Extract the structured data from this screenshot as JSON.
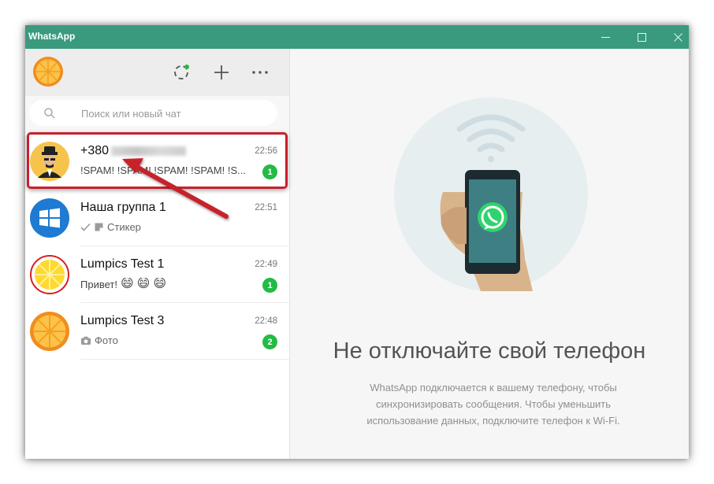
{
  "window": {
    "title": "WhatsApp",
    "minimize": "—",
    "maximize": "☐",
    "close": "✕"
  },
  "sidebar": {
    "search": {
      "placeholder": "Поиск или новый чат"
    },
    "chats": [
      {
        "name": "+380",
        "name_blurred": true,
        "time": "22:56",
        "preview": "!SPAM! !SPAM! !SPAM! !SPAM! !S...",
        "unread": "1",
        "avatar": "spy-avatar",
        "highlighted": true
      },
      {
        "name": "Наша группа 1",
        "time": "22:51",
        "preview_icons": [
          "check-icon",
          "sticker-icon"
        ],
        "preview": "Стикер",
        "avatar": "windows-logo-avatar"
      },
      {
        "name": "Lumpics Test 1",
        "time": "22:49",
        "preview": "Привет!",
        "preview_emojis": [
          "😄",
          "😄",
          "😄"
        ],
        "unread": "1",
        "avatar": "lemon-avatar"
      },
      {
        "name": "Lumpics Test 3",
        "time": "22:48",
        "preview_icons": [
          "camera-icon"
        ],
        "preview": "Фото",
        "unread": "2",
        "avatar": "orange-avatar"
      }
    ]
  },
  "main": {
    "title": "Не отключайте свой телефон",
    "description": "WhatsApp подключается к вашему телефону, чтобы синхронизировать сообщения. Чтобы уменьшить использование данных, подключите телефон к Wi-Fi."
  },
  "colors": {
    "titlebar": "#3a9a7e",
    "badge": "#23bb44",
    "highlight": "#c7202b",
    "status_dot": "#23bb44"
  }
}
